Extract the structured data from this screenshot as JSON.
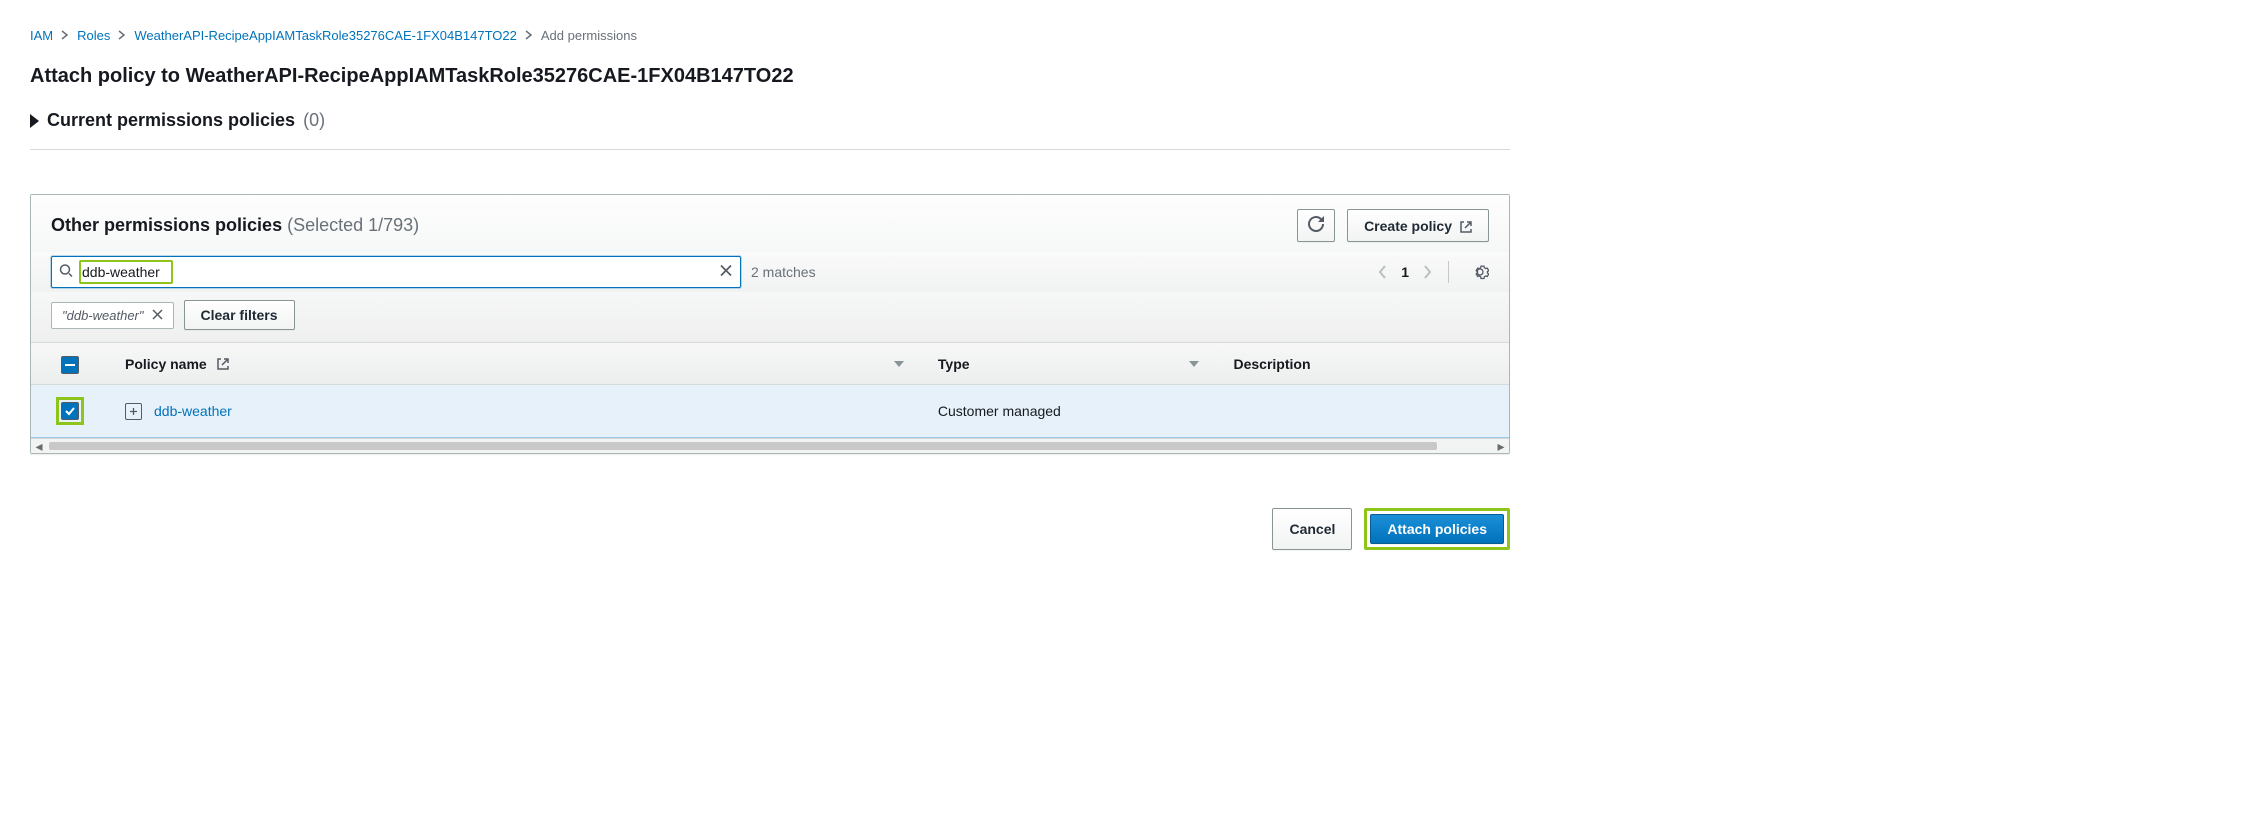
{
  "breadcrumb": {
    "items": [
      "IAM",
      "Roles",
      "WeatherAPI-RecipeAppIAMTaskRole35276CAE-1FX04B147TO22"
    ],
    "current": "Add permissions"
  },
  "page_title": "Attach policy to WeatherAPI-RecipeAppIAMTaskRole35276CAE-1FX04B147TO22",
  "current_policies": {
    "label": "Current permissions policies",
    "count": "(0)"
  },
  "other_policies": {
    "title": "Other permissions policies",
    "subtitle": "(Selected 1/793)",
    "refresh_aria": "Refresh",
    "create_label": "Create policy"
  },
  "search": {
    "value": "ddb-weather",
    "matches": "2 matches"
  },
  "chips": {
    "filter_chip": "\"ddb-weather\"",
    "clear_filters": "Clear filters"
  },
  "pager": {
    "page": "1"
  },
  "table": {
    "headers": {
      "policy_name": "Policy name",
      "type": "Type",
      "description": "Description"
    },
    "rows": [
      {
        "name": "ddb-weather",
        "type": "Customer managed",
        "description": ""
      }
    ]
  },
  "footer": {
    "cancel": "Cancel",
    "attach": "Attach policies"
  }
}
